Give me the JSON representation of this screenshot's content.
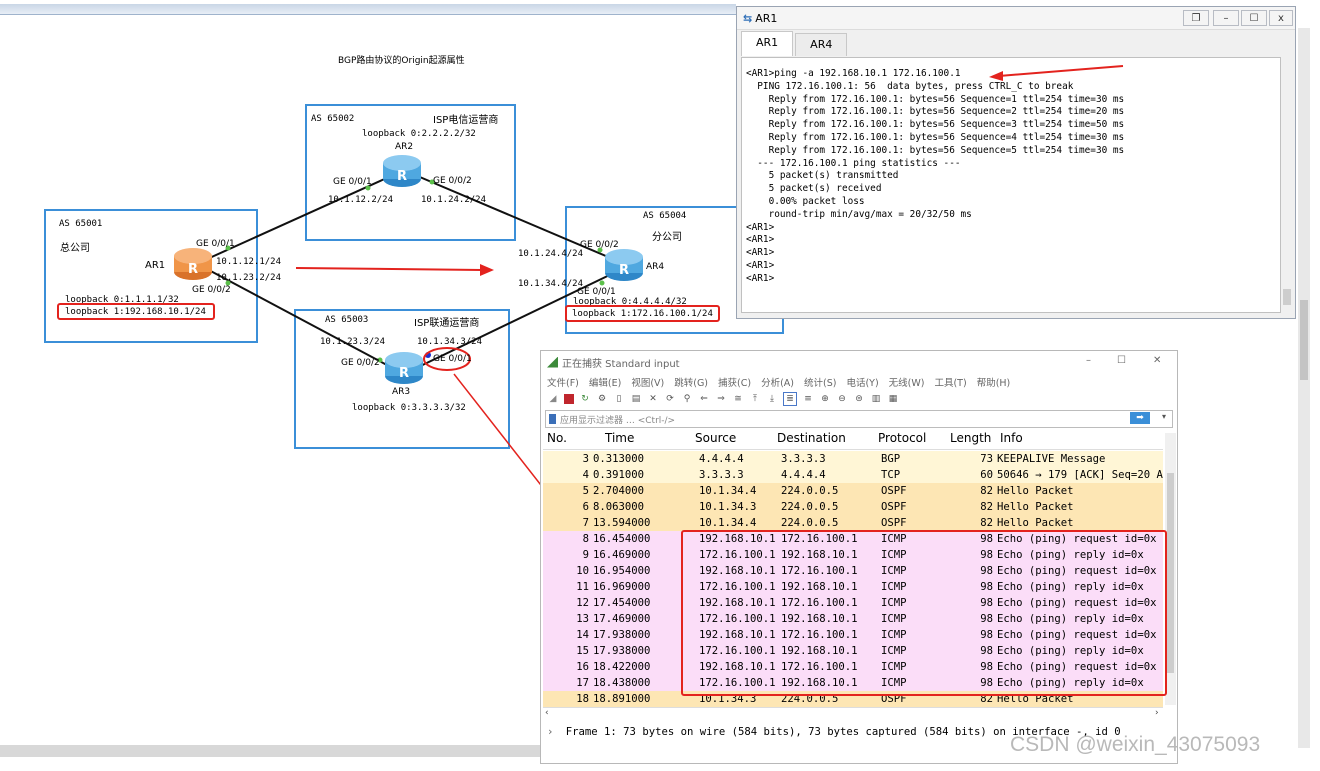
{
  "topology": {
    "title": "BGP路由协议的Origin起源属性",
    "as_boxes": [
      {
        "id": "65001",
        "label": "AS 65001",
        "sublabel": "总公司"
      },
      {
        "id": "65002",
        "label": "AS 65002",
        "sublabel": "ISP电信运营商"
      },
      {
        "id": "65003",
        "label": "AS 65003",
        "sublabel": "ISP联通运营商"
      },
      {
        "id": "65004",
        "label": "AS 65004",
        "sublabel": "分公司"
      }
    ],
    "routers": {
      "ar1": "AR1",
      "ar2": "AR2",
      "ar3": "AR3",
      "ar4": "AR4"
    },
    "labels": {
      "ar1_if1": "GE 0/0/1",
      "ar1_ip1": "10.1.12.1/24",
      "ar1_if2": "GE 0/0/2",
      "ar1_ip2": "10.1.23.2/24",
      "ar1_lb0": "loopback 0:1.1.1.1/32",
      "ar1_lb1": "loopback 1:192.168.10.1/24",
      "ar2_lb0": "loopback 0:2.2.2.2/32",
      "ar2_if1": "GE 0/0/1",
      "ar2_ip1": "10.1.12.2/24",
      "ar2_if2": "GE 0/0/2",
      "ar2_ip2": "10.1.24.2/24",
      "ar3_ip1": "10.1.23.3/24",
      "ar3_if2": "GE 0/0/2",
      "ar3_ip2": "10.1.34.3/24",
      "ar3_if1": "GE 0/0/1",
      "ar3_lb0": "loopback 0:3.3.3.3/32",
      "ar4_if2": "GE 0/0/2",
      "ar4_ip1": "10.1.24.4/24",
      "ar4_ip2": "10.1.34.4/24",
      "ar4_if1": "GE 0/0/1",
      "ar4_lb0": "loopback 0:4.4.4.4/32",
      "ar4_lb1": "loopback 1:172.16.100.1/24"
    }
  },
  "terminal": {
    "window_title": "AR1",
    "tabs": [
      "AR1",
      "AR4"
    ],
    "active_tab": "AR1",
    "lines": [
      "<AR1>ping -a 192.168.10.1 172.16.100.1",
      "  PING 172.16.100.1: 56  data bytes, press CTRL_C to break",
      "    Reply from 172.16.100.1: bytes=56 Sequence=1 ttl=254 time=30 ms",
      "    Reply from 172.16.100.1: bytes=56 Sequence=2 ttl=254 time=20 ms",
      "    Reply from 172.16.100.1: bytes=56 Sequence=3 ttl=254 time=50 ms",
      "    Reply from 172.16.100.1: bytes=56 Sequence=4 ttl=254 time=30 ms",
      "    Reply from 172.16.100.1: bytes=56 Sequence=5 ttl=254 time=30 ms",
      "",
      "  --- 172.16.100.1 ping statistics ---",
      "    5 packet(s) transmitted",
      "    5 packet(s) received",
      "    0.00% packet loss",
      "    round-trip min/avg/max = 20/32/50 ms",
      "",
      "<AR1>",
      "<AR1>",
      "<AR1>",
      "<AR1>",
      "<AR1>"
    ]
  },
  "wireshark": {
    "title": "正在捕获 Standard input",
    "menu": [
      "文件(F)",
      "编辑(E)",
      "视图(V)",
      "跳转(G)",
      "捕获(C)",
      "分析(A)",
      "统计(S)",
      "电话(Y)",
      "无线(W)",
      "工具(T)",
      "帮助(H)"
    ],
    "filter_placeholder": "应用显示过滤器 … <Ctrl-/>",
    "columns": [
      "No.",
      "Time",
      "Source",
      "Destination",
      "Protocol",
      "Length",
      "Info"
    ],
    "packets": [
      {
        "no": "3",
        "time": "0.313000",
        "src": "4.4.4.4",
        "dst": "3.3.3.3",
        "proto": "BGP",
        "len": "73",
        "info": "KEEPALIVE Message"
      },
      {
        "no": "4",
        "time": "0.391000",
        "src": "3.3.3.3",
        "dst": "4.4.4.4",
        "proto": "TCP",
        "len": "60",
        "info": "50646 → 179 [ACK] Seq=20 A"
      },
      {
        "no": "5",
        "time": "2.704000",
        "src": "10.1.34.4",
        "dst": "224.0.0.5",
        "proto": "OSPF",
        "len": "82",
        "info": "Hello Packet"
      },
      {
        "no": "6",
        "time": "8.063000",
        "src": "10.1.34.3",
        "dst": "224.0.0.5",
        "proto": "OSPF",
        "len": "82",
        "info": "Hello Packet"
      },
      {
        "no": "7",
        "time": "13.594000",
        "src": "10.1.34.4",
        "dst": "224.0.0.5",
        "proto": "OSPF",
        "len": "82",
        "info": "Hello Packet"
      },
      {
        "no": "8",
        "time": "16.454000",
        "src": "192.168.10.1",
        "dst": "172.16.100.1",
        "proto": "ICMP",
        "len": "98",
        "info": "Echo (ping) request  id=0x"
      },
      {
        "no": "9",
        "time": "16.469000",
        "src": "172.16.100.1",
        "dst": "192.168.10.1",
        "proto": "ICMP",
        "len": "98",
        "info": "Echo (ping) reply    id=0x"
      },
      {
        "no": "10",
        "time": "16.954000",
        "src": "192.168.10.1",
        "dst": "172.16.100.1",
        "proto": "ICMP",
        "len": "98",
        "info": "Echo (ping) request  id=0x"
      },
      {
        "no": "11",
        "time": "16.969000",
        "src": "172.16.100.1",
        "dst": "192.168.10.1",
        "proto": "ICMP",
        "len": "98",
        "info": "Echo (ping) reply    id=0x"
      },
      {
        "no": "12",
        "time": "17.454000",
        "src": "192.168.10.1",
        "dst": "172.16.100.1",
        "proto": "ICMP",
        "len": "98",
        "info": "Echo (ping) request  id=0x"
      },
      {
        "no": "13",
        "time": "17.469000",
        "src": "172.16.100.1",
        "dst": "192.168.10.1",
        "proto": "ICMP",
        "len": "98",
        "info": "Echo (ping) reply    id=0x"
      },
      {
        "no": "14",
        "time": "17.938000",
        "src": "192.168.10.1",
        "dst": "172.16.100.1",
        "proto": "ICMP",
        "len": "98",
        "info": "Echo (ping) request  id=0x"
      },
      {
        "no": "15",
        "time": "17.938000",
        "src": "172.16.100.1",
        "dst": "192.168.10.1",
        "proto": "ICMP",
        "len": "98",
        "info": "Echo (ping) reply    id=0x"
      },
      {
        "no": "16",
        "time": "18.422000",
        "src": "192.168.10.1",
        "dst": "172.16.100.1",
        "proto": "ICMP",
        "len": "98",
        "info": "Echo (ping) request  id=0x"
      },
      {
        "no": "17",
        "time": "18.438000",
        "src": "172.16.100.1",
        "dst": "192.168.10.1",
        "proto": "ICMP",
        "len": "98",
        "info": "Echo (ping) reply    id=0x"
      },
      {
        "no": "18",
        "time": "18.891000",
        "src": "10.1.34.3",
        "dst": "224.0.0.5",
        "proto": "OSPF",
        "len": "82",
        "info": "Hello Packet"
      }
    ],
    "detail": "Frame 1: 73 bytes on wire (584 bits), 73 bytes captured (584 bits) on interface -, id 0"
  },
  "watermark": "CSDN @weixin_43075093",
  "colors": {
    "as_border": "#3b8fd8",
    "highlight": "#e3231e",
    "row_bgp_tcp": "#fff6d6",
    "row_ospf": "#fde6b4",
    "row_icmp": "#fbddf8",
    "router_blue": "#4fa8e0",
    "router_orange": "#f09548"
  }
}
